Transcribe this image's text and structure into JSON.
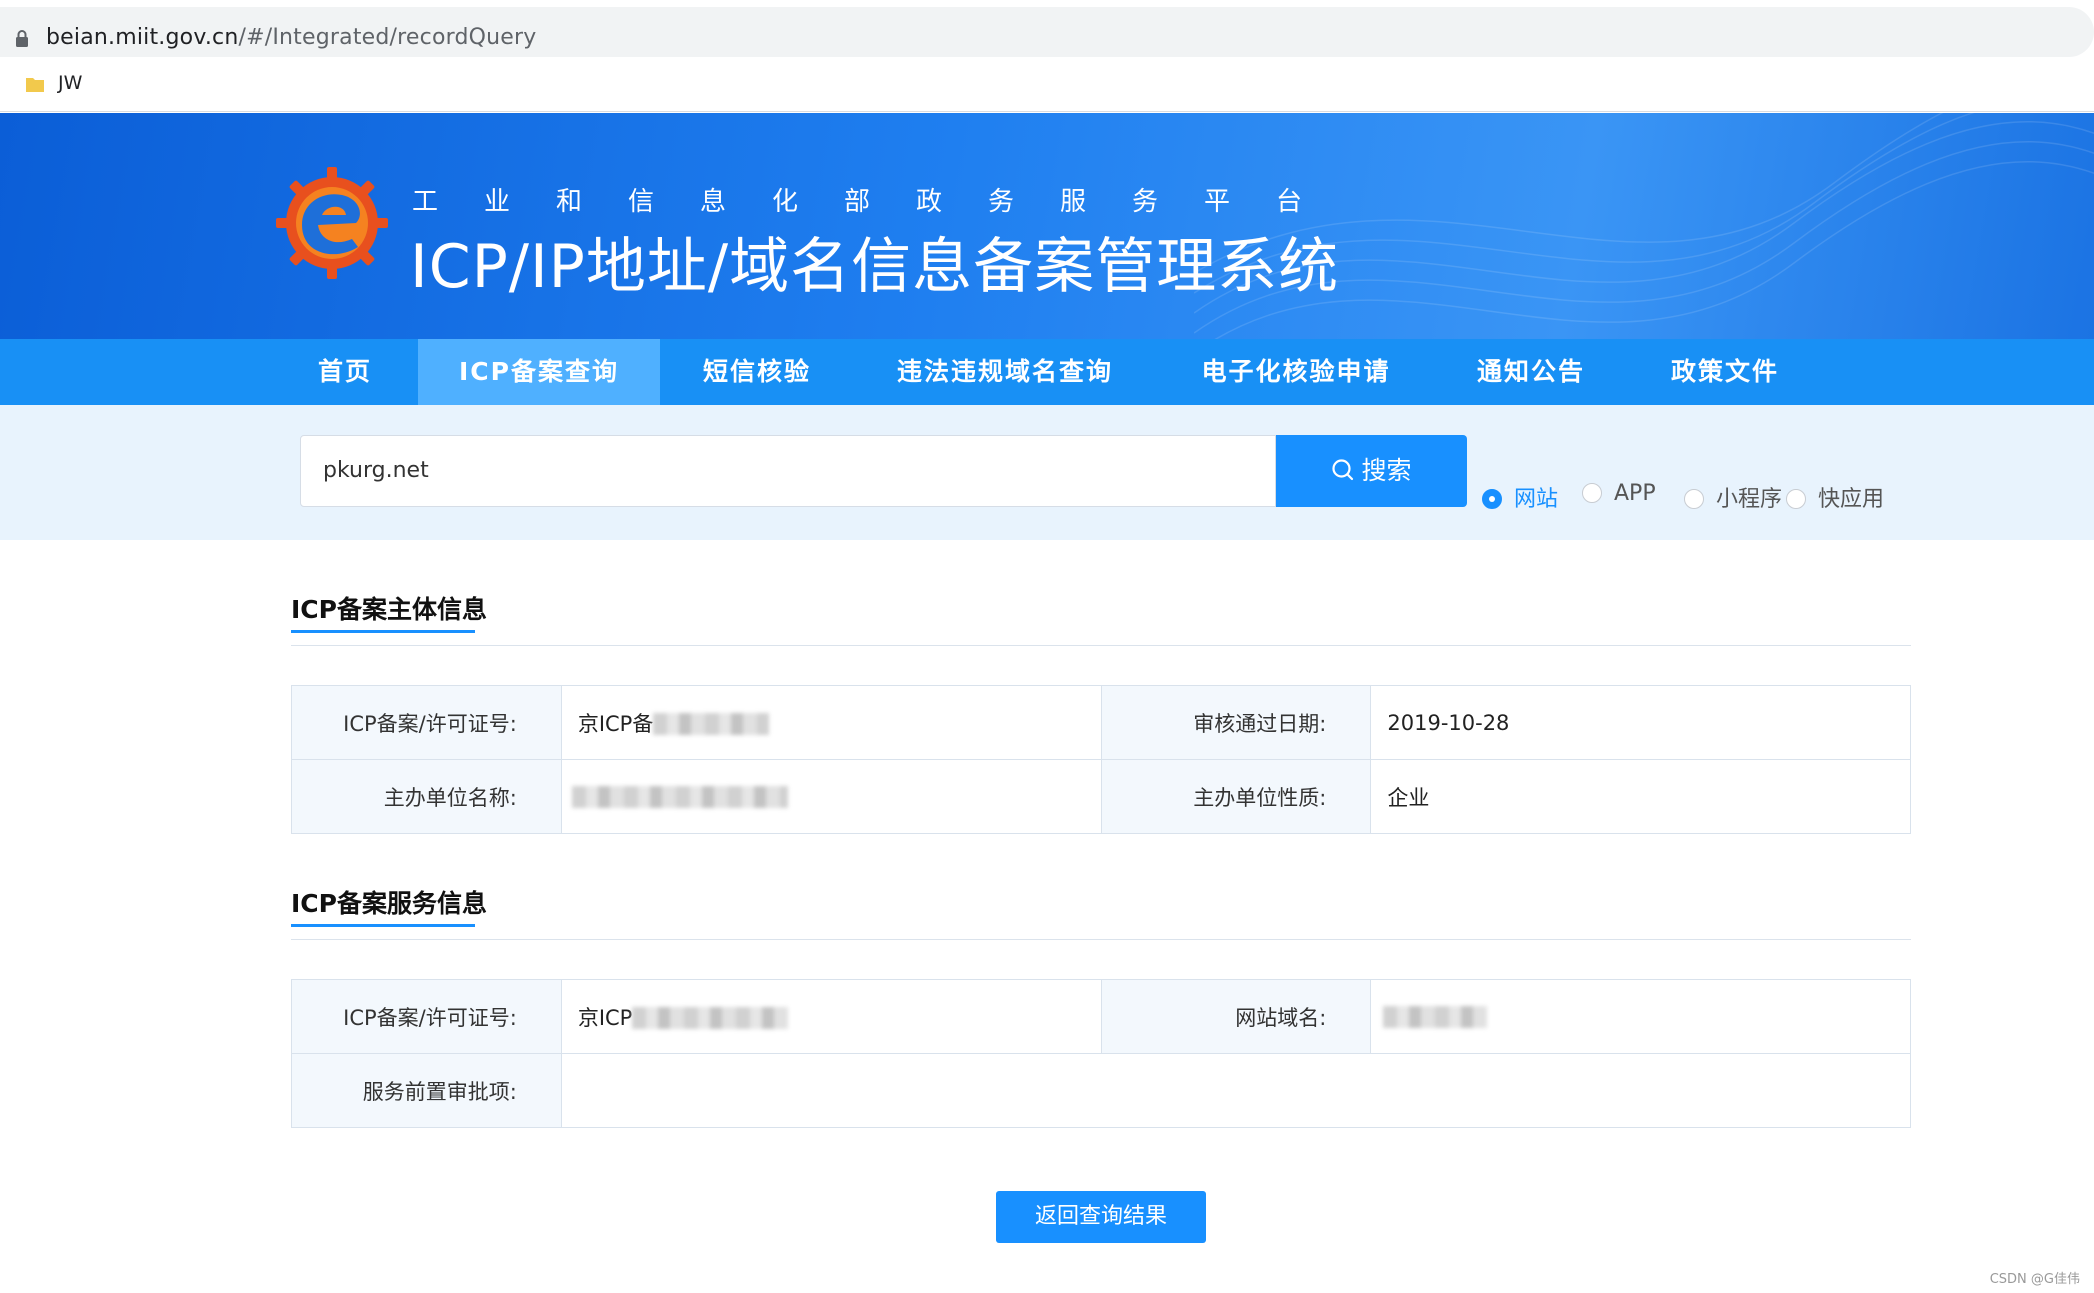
{
  "browser": {
    "url_host": "beian.miit.gov.cn",
    "url_rest": "/#/Integrated/recordQuery",
    "bookmark": "JW"
  },
  "banner": {
    "subtitle": "工业和信息化部政务服务平台",
    "title": "ICP/IP地址/域名信息备案管理系统"
  },
  "nav": {
    "items": [
      "首页",
      "ICP备案查询",
      "短信核验",
      "违法违规域名查询",
      "电子化核验申请",
      "通知公告",
      "政策文件"
    ],
    "active": "ICP备案查询"
  },
  "search": {
    "value": "pkurg.net",
    "button": "搜索",
    "options": [
      "网站",
      "APP",
      "小程序",
      "快应用"
    ],
    "selected": "网站"
  },
  "subject": {
    "title": "ICP备案主体信息",
    "license_label": "ICP备案/许可证号:",
    "license_value": "京ICP备",
    "date_label": "审核通过日期:",
    "date_value": "2019-10-28",
    "org_label": "主办单位名称:",
    "nature_label": "主办单位性质:",
    "nature_value": "企业"
  },
  "service": {
    "title": "ICP备案服务信息",
    "license_label": "ICP备案/许可证号:",
    "license_value": "京ICP",
    "domain_label": "网站域名:",
    "approval_label": "服务前置审批项:"
  },
  "back_button": "返回查询结果",
  "watermark": "CSDN @G佳伟"
}
